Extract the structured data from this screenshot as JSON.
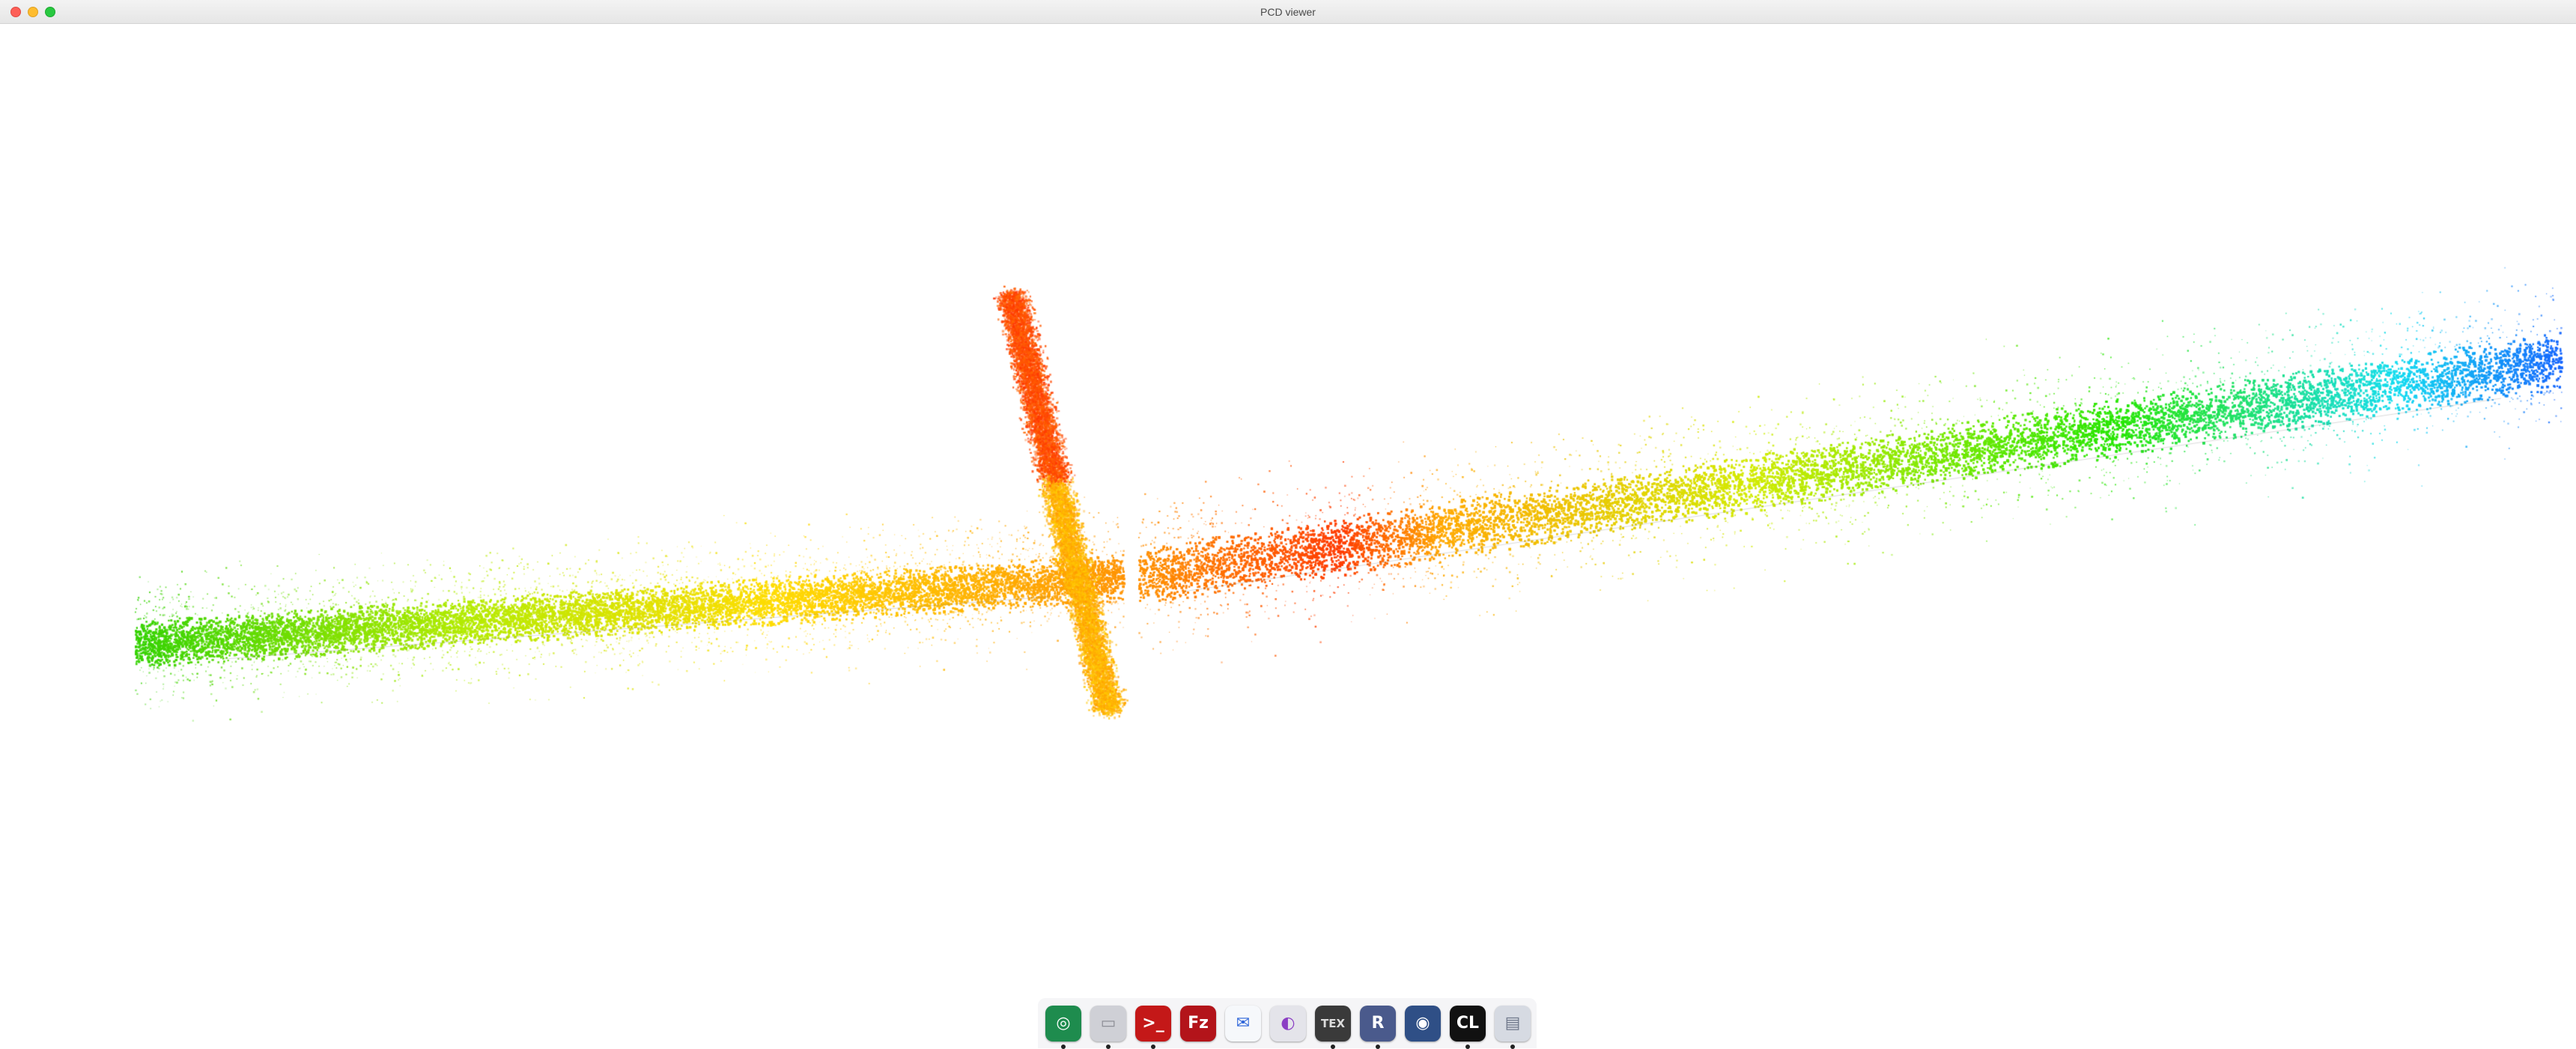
{
  "window": {
    "title": "PCD viewer"
  },
  "dock": {
    "items": [
      {
        "name": "chrome-icon",
        "glyph": "◎",
        "bg": "#1e8c4e",
        "fg": "#ffffff",
        "running": true
      },
      {
        "name": "files-folder-icon",
        "glyph": "▭",
        "bg": "#cfd0d6",
        "fg": "#8e8f97",
        "running": true
      },
      {
        "name": "terminal-icon",
        "glyph": ">_",
        "bg": "#c41818",
        "fg": "#ffffff",
        "running": true
      },
      {
        "name": "filezilla-icon",
        "glyph": "Fz",
        "bg": "#b3141a",
        "fg": "#ffffff",
        "running": false
      },
      {
        "name": "mail-app-icon",
        "glyph": "✉",
        "bg": "#f6f8fb",
        "fg": "#2b63d9",
        "running": false
      },
      {
        "name": "settings-toggle-icon",
        "glyph": "◐",
        "bg": "#e4e4ea",
        "fg": "#8b3fc4",
        "running": false
      },
      {
        "name": "tex-editor-icon",
        "glyph": "TEX",
        "bg": "#3a3a3a",
        "fg": "#dcdcdc",
        "running": true
      },
      {
        "name": "jetbrains-rider-icon",
        "glyph": "R",
        "bg": "#4a5a8c",
        "fg": "#ffffff",
        "running": true
      },
      {
        "name": "screenshot-camera-icon",
        "glyph": "◉",
        "bg": "#2f4f86",
        "fg": "#ffffff",
        "running": false
      },
      {
        "name": "clion-icon",
        "glyph": "CL",
        "bg": "#111111",
        "fg": "#ffffff",
        "running": true
      },
      {
        "name": "window-preview-icon",
        "glyph": "▤",
        "bg": "#d6dae2",
        "fg": "#6d7689",
        "running": true
      }
    ]
  },
  "pointcloud": {
    "colormap": "rainbow (height/position coded)",
    "colors": {
      "red": "#ff2a00",
      "orange": "#ff8800",
      "yellow": "#ffe000",
      "green": "#22e000",
      "cyan": "#18d8ff",
      "blue": "#1a6cff"
    }
  }
}
